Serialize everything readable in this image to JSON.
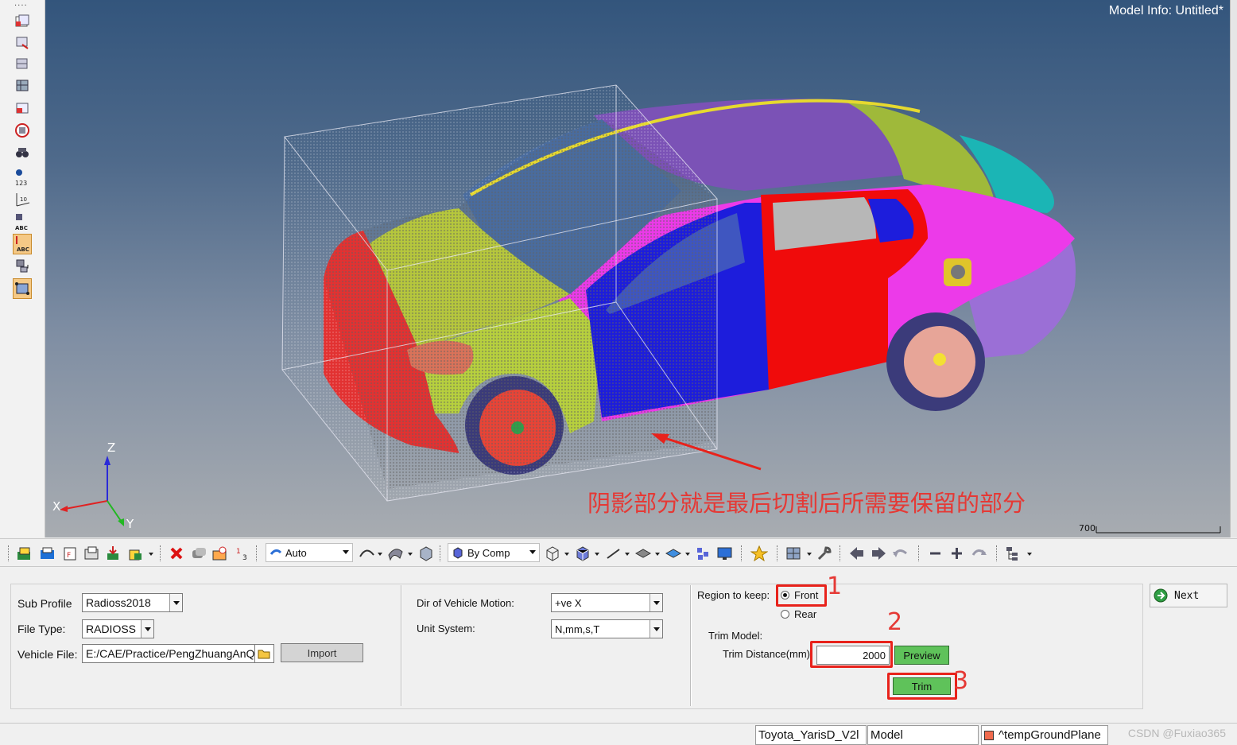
{
  "viewport": {
    "model_info": "Model Info: Untitled*",
    "annotation": "阴影部分就是最后切割后所需要保留的部分",
    "axes": {
      "x": "X",
      "y": "Y",
      "z": "Z"
    },
    "scale_label": "700"
  },
  "left_toolbar": {
    "icons": [
      "component-icon",
      "find-icon",
      "mask-icon",
      "unmask-icon",
      "show-icon",
      "isolate-icon",
      "binoculars-icon",
      "numbers-icon",
      "ruler-icon",
      "label-abc-icon",
      "label-abc-active-icon",
      "swap-icon",
      "frame-icon"
    ]
  },
  "toolbar": {
    "auto_combo": "Auto",
    "bycomp_combo": "By Comp"
  },
  "panel": {
    "sub_profile": {
      "label": "Sub Profile",
      "value": "Radioss2018"
    },
    "file_type": {
      "label": "File Type:",
      "value": "RADIOSS"
    },
    "vehicle_file": {
      "label": "Vehicle File:",
      "value": "E:/CAE/Practice/PengZhuangAnQu"
    },
    "import_label": "Import",
    "dir_motion": {
      "label": "Dir of Vehicle Motion:",
      "value": "+ve X"
    },
    "unit_system": {
      "label": "Unit System:",
      "value": "N,mm,s,T"
    },
    "region_label": "Region to keep:",
    "front_label": "Front",
    "rear_label": "Rear",
    "trim_model_label": "Trim Model:",
    "trim_distance_label": "Trim Distance(mm):",
    "trim_distance_value": "2000",
    "preview_label": "Preview",
    "trim_label": "Trim",
    "next_label": "Next",
    "callouts": [
      "1",
      "2",
      "3"
    ]
  },
  "statusbar": {
    "model_name": "Toyota_YarisD_V2l",
    "mode": "Model",
    "component": "^tempGroundPlane",
    "watermark": "CSDN @Fuxiao365"
  },
  "colors": {
    "accent_red": "#e8221b",
    "button_green": "#5fc25a"
  }
}
